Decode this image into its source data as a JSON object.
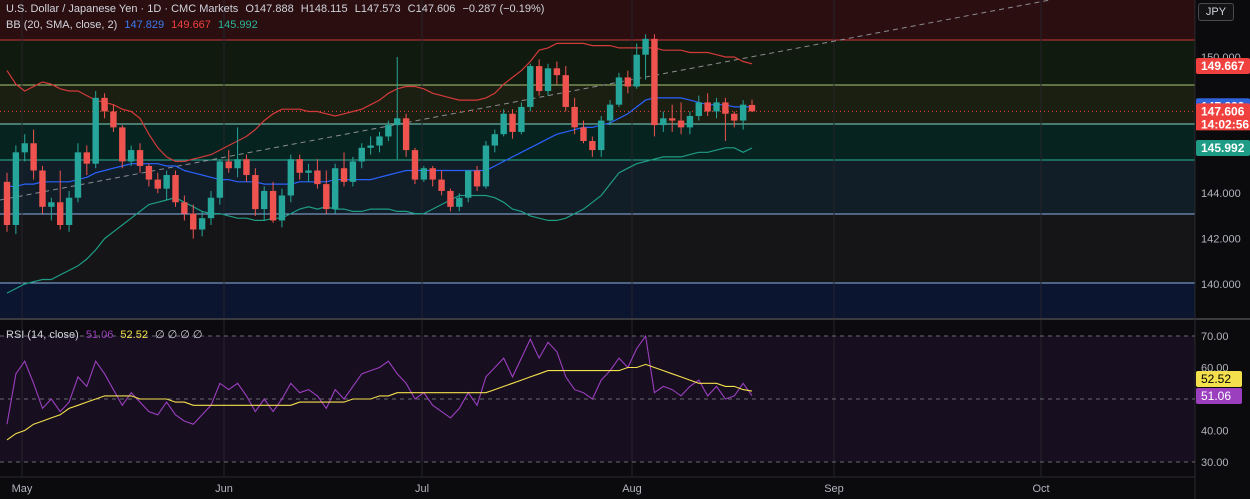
{
  "header": {
    "symbol": "U.S. Dollar / Japanese Yen · 1D · CMC Markets",
    "open": "O147.888",
    "high": "H148.115",
    "low": "L147.573",
    "close": "C147.606",
    "change": "−0.287 (−0.19%)",
    "bb_label": "BB (20, SMA, close, 2)",
    "bb_basis": "147.829",
    "bb_upper": "149.667",
    "bb_lower": "145.992",
    "rsi_label": "RSI (14, close)",
    "rsi_value": "51.06",
    "rsi_ma": "52.52",
    "rsi_extra": "∅ ∅ ∅ ∅"
  },
  "currency_button": "JPY",
  "price_axis": {
    "ticks": [
      "150.000",
      "146.000",
      "144.000",
      "142.000",
      "140.000"
    ]
  },
  "rsi_axis": {
    "ticks": [
      "70.00",
      "60.00",
      "40.00",
      "30.00"
    ]
  },
  "price_tags": [
    {
      "label": "149.667",
      "color": "#f0413e"
    },
    {
      "label": "147.829",
      "color": "#2f63d8"
    },
    {
      "label": "147.606",
      "color": "#f0413e"
    },
    {
      "label": "14:02:56",
      "color": "#f0413e"
    },
    {
      "label": "145.992",
      "color": "#1e9c85"
    }
  ],
  "rsi_tags": [
    {
      "label": "52.52",
      "color": "#f4e04d"
    },
    {
      "label": "51.06",
      "color": "#9b3fbf"
    }
  ],
  "time_axis": [
    "May",
    "Jun",
    "Jul",
    "Aug",
    "Sep",
    "Oct"
  ],
  "colors": {
    "up": "#26a69a",
    "down": "#ef5350",
    "basis": "#2962ff",
    "upper": "#d43a3a",
    "lower": "#1e9c85",
    "rsi": "#9b3fbf",
    "rsima": "#f4e04d"
  },
  "chart_data": {
    "type": "candlestick",
    "y_range": [
      139.0,
      151.0
    ],
    "rsi_range": [
      25,
      75
    ],
    "candles_x_days": "trading days from Apr 29 to Aug 16",
    "ohlc": [
      [
        144.5,
        144.9,
        142.3,
        142.6
      ],
      [
        142.6,
        146.1,
        142.2,
        145.8
      ],
      [
        145.8,
        146.6,
        145.4,
        146.2
      ],
      [
        146.2,
        146.8,
        144.6,
        145.0
      ],
      [
        145.0,
        145.2,
        143.1,
        143.4
      ],
      [
        143.4,
        143.8,
        142.8,
        143.6
      ],
      [
        143.6,
        145.0,
        142.4,
        142.6
      ],
      [
        142.6,
        144.1,
        142.3,
        143.8
      ],
      [
        143.8,
        146.2,
        143.6,
        145.8
      ],
      [
        145.8,
        146.1,
        144.8,
        145.3
      ],
      [
        145.3,
        148.5,
        145.1,
        148.2
      ],
      [
        148.2,
        148.4,
        147.3,
        147.6
      ],
      [
        147.6,
        147.9,
        146.7,
        146.9
      ],
      [
        146.9,
        147.0,
        145.1,
        145.4
      ],
      [
        145.4,
        146.1,
        145.2,
        145.9
      ],
      [
        145.9,
        146.2,
        144.9,
        145.2
      ],
      [
        145.2,
        145.3,
        144.3,
        144.6
      ],
      [
        144.6,
        144.9,
        144.0,
        144.2
      ],
      [
        144.2,
        145.0,
        143.7,
        144.8
      ],
      [
        144.8,
        145.0,
        143.4,
        143.6
      ],
      [
        143.6,
        143.9,
        142.8,
        143.1
      ],
      [
        143.1,
        143.5,
        142.0,
        142.4
      ],
      [
        142.4,
        143.2,
        142.1,
        142.9
      ],
      [
        142.9,
        144.1,
        142.6,
        143.8
      ],
      [
        143.8,
        145.5,
        143.5,
        145.4
      ],
      [
        145.4,
        145.9,
        144.9,
        145.1
      ],
      [
        145.1,
        146.9,
        144.7,
        145.5
      ],
      [
        145.5,
        145.7,
        144.5,
        144.8
      ],
      [
        144.8,
        145.1,
        143.0,
        143.3
      ],
      [
        143.3,
        144.3,
        142.8,
        144.1
      ],
      [
        144.1,
        144.5,
        142.7,
        142.8
      ],
      [
        142.8,
        144.2,
        142.5,
        143.9
      ],
      [
        143.9,
        145.7,
        143.6,
        145.5
      ],
      [
        145.5,
        145.7,
        144.6,
        144.9
      ],
      [
        144.9,
        145.3,
        144.5,
        145.0
      ],
      [
        145.0,
        145.5,
        144.2,
        144.4
      ],
      [
        144.4,
        145.0,
        143.1,
        143.3
      ],
      [
        143.3,
        145.3,
        143.1,
        145.1
      ],
      [
        145.1,
        145.8,
        144.3,
        144.5
      ],
      [
        144.5,
        145.6,
        144.3,
        145.4
      ],
      [
        145.4,
        146.2,
        145.1,
        146.0
      ],
      [
        146.0,
        146.5,
        145.7,
        146.1
      ],
      [
        146.1,
        146.7,
        145.8,
        146.5
      ],
      [
        146.5,
        147.2,
        146.3,
        147.0
      ],
      [
        147.0,
        150.0,
        145.5,
        147.3
      ],
      [
        147.3,
        147.5,
        145.6,
        145.9
      ],
      [
        145.9,
        146.0,
        144.4,
        144.6
      ],
      [
        144.6,
        145.2,
        144.5,
        145.1
      ],
      [
        145.1,
        145.2,
        144.3,
        144.6
      ],
      [
        144.6,
        145.0,
        143.9,
        144.1
      ],
      [
        144.1,
        144.2,
        143.2,
        143.4
      ],
      [
        143.4,
        144.0,
        143.2,
        143.8
      ],
      [
        143.8,
        145.0,
        143.6,
        145.0
      ],
      [
        145.0,
        145.2,
        144.1,
        144.3
      ],
      [
        144.3,
        146.3,
        144.2,
        146.1
      ],
      [
        146.1,
        146.8,
        145.8,
        146.6
      ],
      [
        146.6,
        147.7,
        146.5,
        147.5
      ],
      [
        147.5,
        147.7,
        146.4,
        146.7
      ],
      [
        146.7,
        148.0,
        146.6,
        147.8
      ],
      [
        147.8,
        149.7,
        147.6,
        149.6
      ],
      [
        149.6,
        149.9,
        148.3,
        148.5
      ],
      [
        148.5,
        149.7,
        148.3,
        149.5
      ],
      [
        149.5,
        149.8,
        148.8,
        149.2
      ],
      [
        149.2,
        149.6,
        147.6,
        147.8
      ],
      [
        147.8,
        148.2,
        146.6,
        146.9
      ],
      [
        146.9,
        147.2,
        146.2,
        146.3
      ],
      [
        146.3,
        146.5,
        145.6,
        145.9
      ],
      [
        145.9,
        147.4,
        145.6,
        147.2
      ],
      [
        147.2,
        148.1,
        147.0,
        147.9
      ],
      [
        147.9,
        149.3,
        147.8,
        149.1
      ],
      [
        149.1,
        149.4,
        148.4,
        148.7
      ],
      [
        148.7,
        150.6,
        148.6,
        150.1
      ],
      [
        150.1,
        151.0,
        149.0,
        150.8
      ],
      [
        150.8,
        151.0,
        146.5,
        147.0
      ],
      [
        147.0,
        147.6,
        146.7,
        147.3
      ],
      [
        147.3,
        147.9,
        146.7,
        147.2
      ],
      [
        147.2,
        148.0,
        146.6,
        146.9
      ],
      [
        146.9,
        147.6,
        146.6,
        147.4
      ],
      [
        147.4,
        148.3,
        147.2,
        148.0
      ],
      [
        148.0,
        148.4,
        147.4,
        147.6
      ],
      [
        147.6,
        148.2,
        147.3,
        148.0
      ],
      [
        148.0,
        148.2,
        146.3,
        147.5
      ],
      [
        147.5,
        147.6,
        146.9,
        147.2
      ],
      [
        147.2,
        148.1,
        146.8,
        147.9
      ],
      [
        147.888,
        148.115,
        147.573,
        147.606
      ]
    ],
    "bb_upper": [
      149.4,
      148.8,
      148.5,
      148.7,
      148.9,
      148.8,
      148.6,
      148.5,
      148.5,
      148.3,
      148.1,
      148.0,
      147.9,
      147.7,
      147.6,
      147.3,
      146.6,
      146.0,
      145.6,
      145.4,
      145.4,
      145.5,
      145.6,
      145.7,
      145.9,
      146.1,
      146.3,
      146.5,
      146.8,
      147.2,
      147.5,
      147.7,
      147.7,
      147.7,
      147.6,
      147.6,
      147.5,
      147.4,
      147.5,
      147.6,
      147.7,
      147.9,
      148.1,
      148.4,
      148.6,
      148.7,
      148.7,
      148.6,
      148.4,
      148.3,
      148.2,
      148.1,
      148.1,
      148.1,
      148.2,
      148.4,
      148.8,
      149.1,
      149.4,
      149.8,
      150.3,
      150.4,
      150.6,
      150.6,
      150.6,
      150.6,
      150.5,
      150.5,
      150.5,
      150.4,
      150.4,
      150.4,
      150.4,
      150.4,
      150.3,
      150.3,
      150.3,
      150.2,
      150.2,
      150.2,
      150.1,
      150.0,
      150.0,
      149.8,
      149.7
    ],
    "bb_basis": [
      144.3,
      144.3,
      144.4,
      144.4,
      144.5,
      144.5,
      144.5,
      144.5,
      144.6,
      144.7,
      144.9,
      145.0,
      145.1,
      145.2,
      145.3,
      145.3,
      145.3,
      145.3,
      145.2,
      145.2,
      145.0,
      144.9,
      144.8,
      144.7,
      144.6,
      144.6,
      144.5,
      144.5,
      144.5,
      144.4,
      144.4,
      144.4,
      144.4,
      144.5,
      144.5,
      144.5,
      144.5,
      144.6,
      144.6,
      144.6,
      144.6,
      144.6,
      144.7,
      144.8,
      144.9,
      145.0,
      145.0,
      145.0,
      145.0,
      145.0,
      145.0,
      145.0,
      145.0,
      145.0,
      145.0,
      145.2,
      145.4,
      145.6,
      145.8,
      146.0,
      146.2,
      146.4,
      146.6,
      146.7,
      146.8,
      146.9,
      146.9,
      147.0,
      147.1,
      147.3,
      147.5,
      147.8,
      148.1,
      148.2,
      148.2,
      148.2,
      148.2,
      148.1,
      148.0,
      147.9,
      147.9,
      147.9,
      147.8,
      147.8,
      147.8
    ],
    "bb_lower": [
      139.6,
      139.8,
      140.0,
      140.1,
      140.2,
      140.2,
      140.4,
      140.6,
      140.8,
      141.1,
      141.5,
      142.0,
      142.3,
      142.6,
      142.9,
      143.2,
      143.5,
      143.6,
      143.7,
      143.8,
      143.6,
      143.4,
      143.2,
      143.1,
      143.1,
      143.0,
      142.9,
      142.9,
      142.8,
      142.8,
      142.9,
      142.9,
      143.1,
      143.3,
      143.4,
      143.3,
      143.4,
      143.3,
      143.3,
      143.2,
      143.2,
      143.3,
      143.3,
      143.3,
      143.2,
      143.2,
      143.1,
      143.1,
      143.3,
      143.5,
      143.7,
      143.9,
      143.9,
      143.9,
      143.9,
      143.8,
      143.6,
      143.3,
      143.2,
      143.0,
      142.9,
      142.8,
      142.8,
      142.9,
      143.1,
      143.3,
      143.6,
      143.9,
      144.4,
      144.9,
      145.1,
      145.3,
      145.4,
      145.5,
      145.6,
      145.6,
      145.6,
      145.7,
      145.8,
      145.8,
      145.9,
      146.0,
      146.0,
      145.8,
      145.99
    ],
    "rsi": [
      42,
      58,
      62,
      55,
      47,
      50,
      46,
      49,
      57,
      54,
      62,
      58,
      53,
      48,
      52,
      49,
      46,
      45,
      49,
      45,
      43,
      42,
      45,
      48,
      55,
      53,
      55,
      51,
      46,
      50,
      46,
      50,
      55,
      52,
      53,
      51,
      47,
      53,
      50,
      54,
      58,
      59,
      60,
      62,
      58,
      55,
      50,
      52,
      48,
      46,
      44,
      47,
      52,
      48,
      57,
      60,
      63,
      57,
      63,
      69,
      63,
      68,
      65,
      57,
      53,
      52,
      50,
      56,
      59,
      63,
      60,
      66,
      70,
      52,
      54,
      53,
      51,
      54,
      56,
      51,
      54,
      50,
      51,
      55,
      51.06
    ],
    "rsi_ma": [
      37,
      39,
      40,
      42,
      43,
      44,
      45,
      47,
      48,
      49,
      50,
      51,
      51,
      51,
      51,
      50,
      50,
      50,
      50,
      49,
      49,
      48,
      48,
      48,
      48,
      48,
      48,
      48,
      48,
      48,
      48,
      48,
      48,
      49,
      49,
      49,
      49,
      49,
      49,
      50,
      50,
      50,
      51,
      51,
      52,
      52,
      52,
      52,
      52,
      52,
      52,
      52,
      52,
      52,
      52,
      53,
      54,
      55,
      56,
      57,
      58,
      59,
      59,
      59,
      59,
      59,
      59,
      59,
      59,
      59,
      60,
      60,
      61,
      60,
      59,
      58,
      57,
      56,
      55,
      55,
      55,
      54,
      54,
      53,
      52.52
    ]
  }
}
